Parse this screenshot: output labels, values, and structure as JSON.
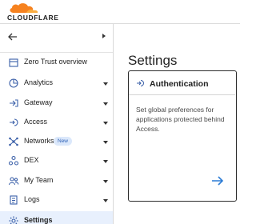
{
  "brand": {
    "name": "CLOUDFLARE"
  },
  "colors": {
    "accent": "#2c7cd5",
    "orange": "#f6821f",
    "active_bg": "#e8f0fd"
  },
  "sidebar": {
    "items": [
      {
        "label": "Zero Trust overview",
        "icon": "overview-icon",
        "caret": false
      },
      {
        "label": "Analytics",
        "icon": "analytics-icon",
        "caret": true
      },
      {
        "label": "Gateway",
        "icon": "gateway-icon",
        "caret": true
      },
      {
        "label": "Access",
        "icon": "access-icon",
        "caret": true
      },
      {
        "label": "Networks",
        "icon": "networks-icon",
        "caret": true,
        "badge": "New"
      },
      {
        "label": "DEX",
        "icon": "dex-icon",
        "caret": true
      },
      {
        "label": "My Team",
        "icon": "team-icon",
        "caret": true
      },
      {
        "label": "Logs",
        "icon": "logs-icon",
        "caret": true
      },
      {
        "label": "Settings",
        "icon": "gear-icon",
        "caret": false,
        "active": true
      }
    ]
  },
  "main": {
    "title": "Settings",
    "card": {
      "title": "Authentication",
      "description": "Set global preferences for applications protected behind Access."
    }
  }
}
